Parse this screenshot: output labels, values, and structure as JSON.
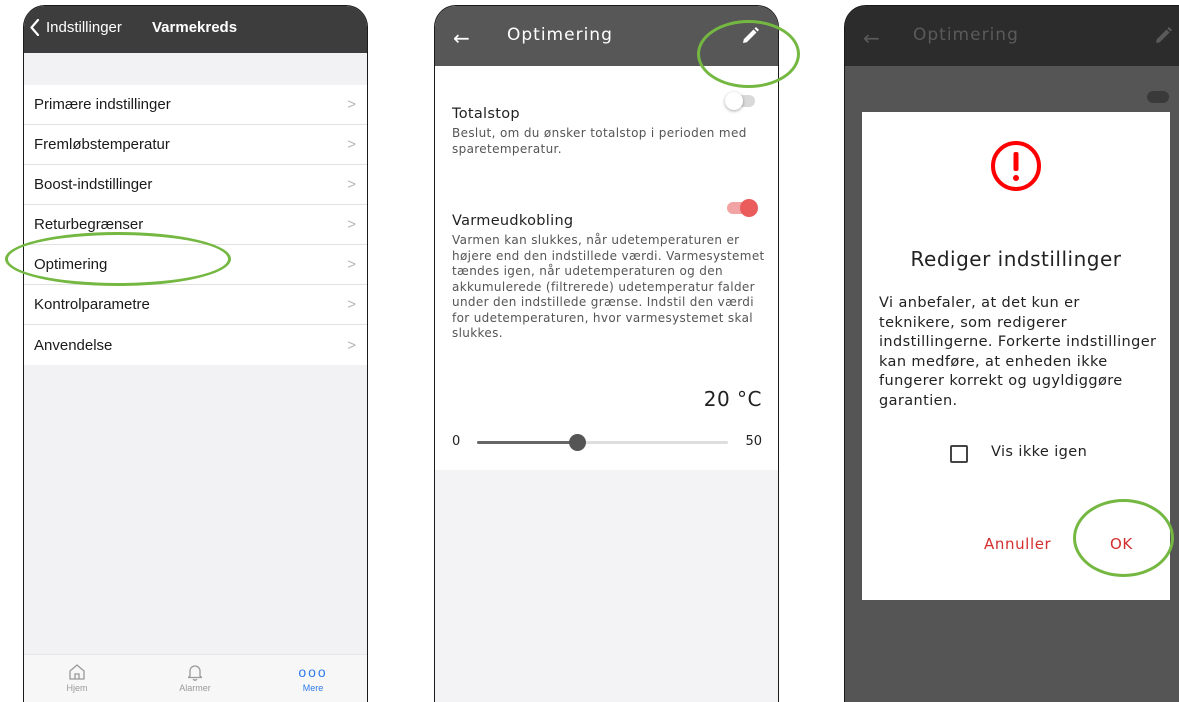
{
  "colors": {
    "highlight": "#74b842",
    "accent_red": "#d32f2f",
    "ios_blue": "#2f7bea",
    "header_dark": "#3d3d3d"
  },
  "screen1": {
    "back_label": "Indstillinger",
    "title": "Varmekreds",
    "menu_items": [
      "Primære indstillinger",
      "Fremløbstemperatur",
      "Boost-indstillinger",
      "Returbegrænser",
      "Optimering",
      "Kontrolparametre",
      "Anvendelse"
    ],
    "highlighted_item": "Optimering",
    "tabbar": [
      {
        "label": "Hjem",
        "icon": "home-icon",
        "active": false
      },
      {
        "label": "Alarmer",
        "icon": "bell-icon",
        "active": false
      },
      {
        "label": "Mere",
        "icon": "more-dots-icon",
        "active": true
      }
    ]
  },
  "screen2": {
    "title": "Optimering",
    "back_icon": "arrow-left-icon",
    "edit_icon": "pencil-icon",
    "settings": [
      {
        "title": "Totalstop",
        "description": "Beslut, om du ønsker totalstop i perioden med sparetemperatur.",
        "toggle_on": false
      },
      {
        "title": "Varmeudkobling",
        "description": "Varmen kan slukkes, når udetemperaturen er højere end den indstillede værdi. Varmesystemet tændes igen, når udetemperaturen og den akkumulerede (filtrerede) udetemperatur falder under den indstillede grænse. Indstil den værdi for udetemperaturen, hvor varmesystemet skal slukkes.",
        "toggle_on": true
      }
    ],
    "temperature": "20 °C",
    "slider": {
      "min": "0",
      "max": "50",
      "value": 20
    }
  },
  "screen3": {
    "title": "Optimering",
    "dialog": {
      "icon": "alert-circle-icon",
      "title": "Rediger indstillinger",
      "message": "Vi anbefaler, at det kun er teknikere, som redigerer indstillingerne. Forkerte indstillinger kan medføre, at enheden ikke fungerer korrekt og ugyldiggøre garantien.",
      "checkbox_label": "Vis ikke igen",
      "checkbox_checked": false,
      "cancel_label": "Annuller",
      "ok_label": "OK"
    }
  }
}
